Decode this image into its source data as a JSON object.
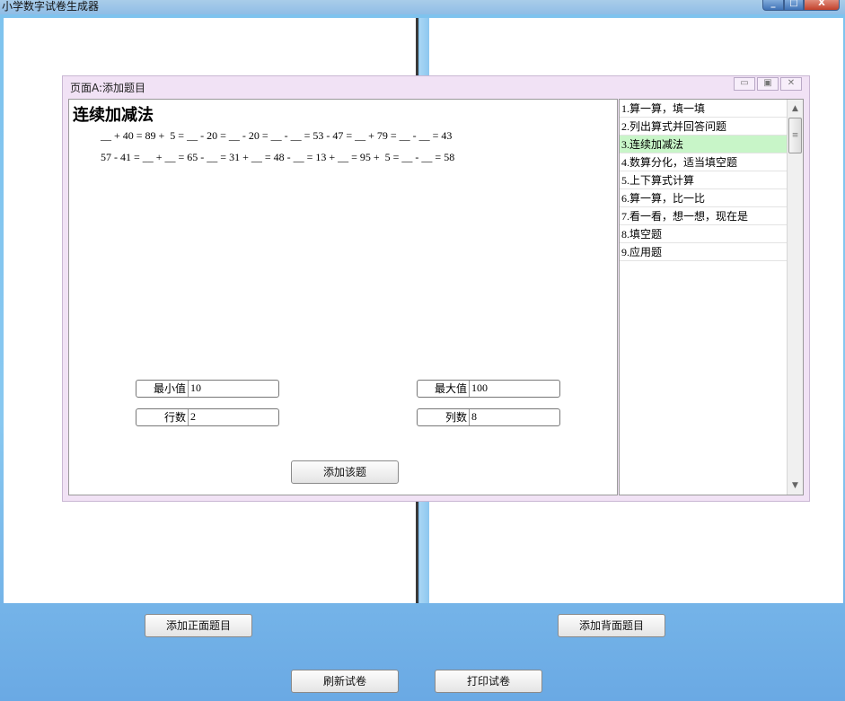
{
  "window": {
    "title": "小学数字试卷生成器",
    "min_label": "_",
    "max_label": "□",
    "close_label": "X"
  },
  "dialog": {
    "title": "页面A:添加题目",
    "min_label": "▭",
    "max_label": "▣",
    "close_label": "✕",
    "heading": "连续加减法",
    "question_lines": [
      "__ + 40 = 89 +  5 = __ - 20 = __ - 20 = __ - __ = 53 - 47 = __ + 79 = __ - __ = 43",
      "57 - 41 = __ + __ = 65 - __ = 31 + __ = 48 - __ = 13 + __ = 95 +  5 = __ - __ = 58"
    ],
    "fields": {
      "min": {
        "label": "最小值",
        "value": "10"
      },
      "max": {
        "label": "最大值",
        "value": "100"
      },
      "rows": {
        "label": "行数",
        "value": "2"
      },
      "cols": {
        "label": "列数",
        "value": "8"
      }
    },
    "add_button": "添加该题",
    "list": [
      {
        "num": "1.",
        "label": "算一算，填一填"
      },
      {
        "num": "2.",
        "label": "列出算式并回答问题"
      },
      {
        "num": "3.",
        "label": "连续加减法"
      },
      {
        "num": "4.",
        "label": "数算分化，适当填空题"
      },
      {
        "num": "5.",
        "label": "上下算式计算"
      },
      {
        "num": "6.",
        "label": "算一算，比一比"
      },
      {
        "num": "7.",
        "label": "看一看，想一想，现在是"
      },
      {
        "num": "8.",
        "label": "填空题"
      },
      {
        "num": "9.",
        "label": "应用题"
      }
    ],
    "selected_index": 2,
    "scroll_up": "▲",
    "scroll_down": "▼",
    "scroll_grip": "≡"
  },
  "buttons": {
    "add_front": "添加正面题目",
    "add_back": "添加背面题目",
    "refresh": "刷新试卷",
    "print": "打印试卷"
  }
}
